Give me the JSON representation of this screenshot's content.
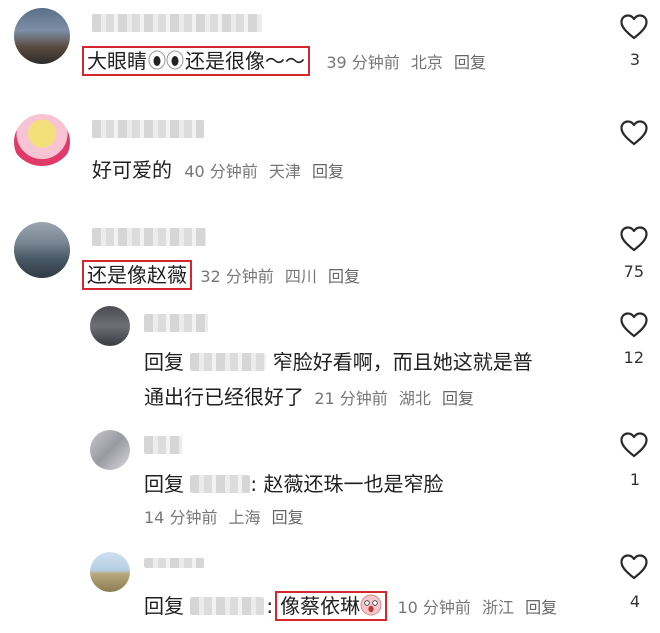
{
  "comments": [
    {
      "text": "大眼睛",
      "suffix": "还是很像～～",
      "time": "39 分钟前",
      "location": "北京",
      "reply_label": "回复",
      "likes": "3"
    },
    {
      "text": "好可爱的",
      "time": "40 分钟前",
      "location": "天津",
      "reply_label": "回复",
      "likes": ""
    },
    {
      "text": "还是像赵薇",
      "time": "32 分钟前",
      "location": "四川",
      "reply_label": "回复",
      "likes": "75",
      "replies": [
        {
          "prefix": "回复",
          "text_line1": "窄脸好看啊，而且她这就是普",
          "text_line2": "通出行已经很好了",
          "time": "21 分钟前",
          "location": "湖北",
          "reply_label": "回复",
          "likes": "12"
        },
        {
          "prefix": "回复",
          "text": ": 赵薇还珠一也是窄脸",
          "time": "14 分钟前",
          "location": "上海",
          "reply_label": "回复",
          "likes": "1"
        },
        {
          "prefix": "回复",
          "text": "像蔡依琳",
          "time": "10 分钟前",
          "location": "浙江",
          "reply_label": "回复",
          "likes": "4"
        }
      ]
    }
  ],
  "icons": {
    "like": "heart-outline-icon",
    "eyes": "eyes-emoji-icon",
    "shocked": "shocked-face-emoji-icon"
  },
  "colors": {
    "highlight": "#d4272d",
    "meta": "#777777"
  }
}
